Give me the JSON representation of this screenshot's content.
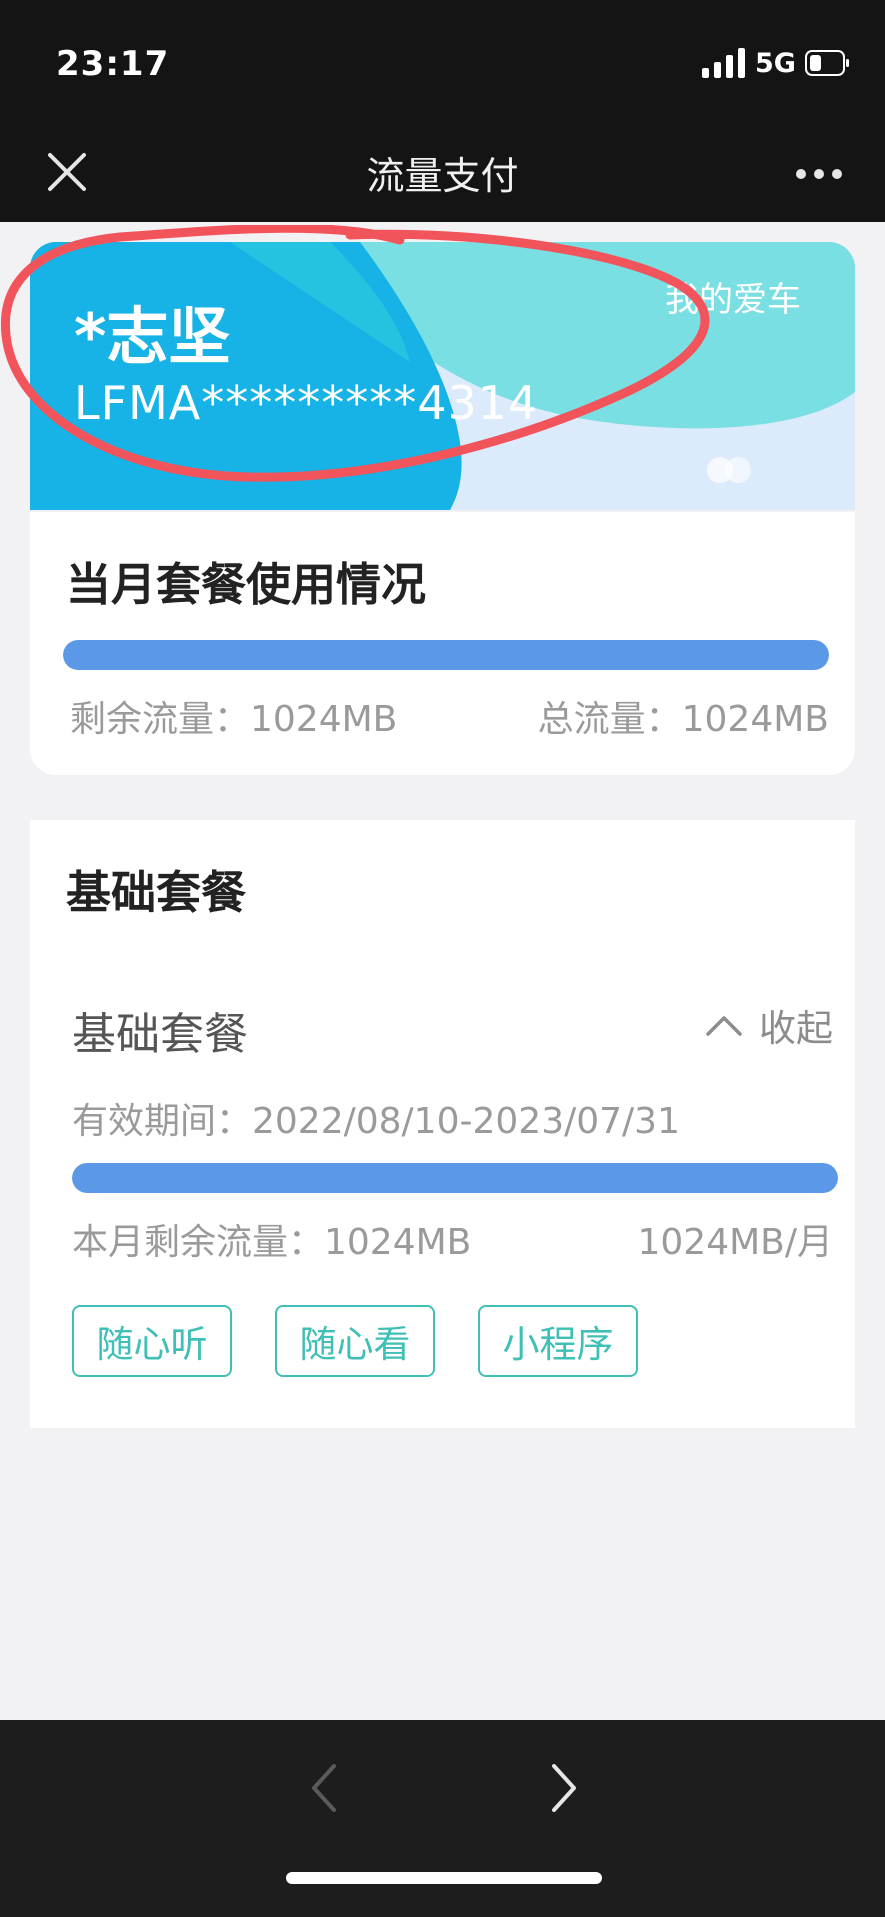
{
  "status_bar": {
    "time": "23:17",
    "network": "5G",
    "icons": [
      "cellular-signal-icon",
      "battery-icon"
    ]
  },
  "nav": {
    "title": "流量支付",
    "close_icon": "close-icon",
    "more_icon": "more-icon"
  },
  "car": {
    "name": "*志坚",
    "vin": "LFMA*********4314",
    "tag": "我的爱车"
  },
  "usage": {
    "title": "当月套餐使用情况",
    "remaining_label": "剩余流量：1024MB",
    "total_label": "总流量：1024MB",
    "remaining_fraction": 1.0
  },
  "basic": {
    "title": "基础套餐",
    "package_name": "基础套餐",
    "collapse_label": "收起",
    "validity": "有效期间：2022/08/10-2023/07/31",
    "remaining_label": "本月剩余流量：1024MB",
    "quota_label": "1024MB/月",
    "remaining_fraction": 1.0,
    "tags": [
      "随心听",
      "随心看",
      "小程序"
    ]
  },
  "colors": {
    "accent_blue": "#5b99e8",
    "teal": "#3fbfb6",
    "annotation_red": "#f2545b",
    "card_blue": "#17b3e6",
    "card_cyan": "#7adfe3"
  }
}
